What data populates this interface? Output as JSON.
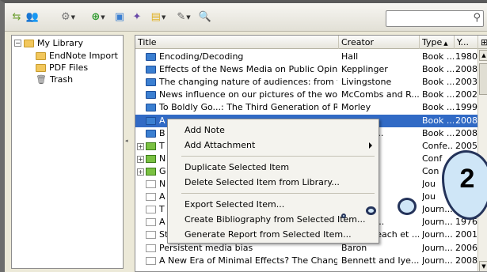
{
  "toolbar": {
    "icons": [
      "sync-icon",
      "group-icon",
      "settings-icon",
      "new-item-icon",
      "new-item-from-file-icon",
      "magic-wand-icon",
      "note-icon",
      "attachment-icon",
      "advanced-search-icon"
    ],
    "search_placeholder": ""
  },
  "library": {
    "root": "My Library",
    "collections": [
      "EndNote Import",
      "PDF Files"
    ],
    "trash": "Trash"
  },
  "table": {
    "columns": {
      "title": "Title",
      "creator": "Creator",
      "type": "Type",
      "year": "Y..."
    },
    "sort_indicator": "▲",
    "rows": [
      {
        "icon": "book",
        "title": "Encoding/Decoding",
        "creator": "Hall",
        "type": "Book ...",
        "year": "1980"
      },
      {
        "icon": "book",
        "title": "Effects of the News Media on Public Opinion",
        "creator": "Kepplinger",
        "type": "Book ...",
        "year": "2008"
      },
      {
        "icon": "book",
        "title": "The changing nature of audiences: from t...",
        "creator": "Livingstone",
        "type": "Book ...",
        "year": "2003"
      },
      {
        "icon": "book",
        "title": "News influence on our pictures of the world",
        "creator": "McCombs and R...",
        "type": "Book ...",
        "year": "2002"
      },
      {
        "icon": "book",
        "title": "To Boldly Go...: The Third Generation of R...",
        "creator": "Morley",
        "type": "Book ...",
        "year": "1999"
      },
      {
        "icon": "book",
        "title": "A",
        "creator": "",
        "type": "Book ...",
        "year": "2008",
        "selected": true
      },
      {
        "icon": "book",
        "title": "B",
        "creator": "n and O...",
        "type": "Book ...",
        "year": "2008"
      },
      {
        "icon": "multi",
        "title": "T",
        "creator": "",
        "type": "Confe...",
        "year": "2005",
        "expander": true
      },
      {
        "icon": "multi",
        "title": "N",
        "creator": "al.",
        "type": "Conf",
        "year": "",
        "expander": true
      },
      {
        "icon": "multi",
        "title": "G",
        "creator": "",
        "type": "Con",
        "year": "",
        "expander": true
      },
      {
        "icon": "doc",
        "title": "N",
        "creator": "d Yu",
        "type": "Jou",
        "year": ""
      },
      {
        "icon": "doc",
        "title": "A",
        "creator": "and T",
        "type": "Jou",
        "year": ""
      },
      {
        "icon": "doc",
        "title": "T",
        "creator": "each",
        "type": "Journ...",
        "year": ""
      },
      {
        "icon": "doc",
        "title": "A",
        "creator": "each an...",
        "type": "Journ...",
        "year": "1976"
      },
      {
        "icon": "doc",
        "title": "Storytelling Neighborhood: Paths to Belon...",
        "creator": "Ball-Rokeach et ...",
        "type": "Journ...",
        "year": "2001"
      },
      {
        "icon": "doc",
        "title": "Persistent media bias",
        "creator": "Baron",
        "type": "Journ...",
        "year": "2006"
      },
      {
        "icon": "doc",
        "title": "A New Era of Minimal Effects? The Changi...",
        "creator": "Bennett and Iye...",
        "type": "Journ...",
        "year": "2008"
      }
    ]
  },
  "context_menu": {
    "add_note": "Add Note",
    "add_attachment": "Add Attachment",
    "duplicate": "Duplicate Selected Item",
    "delete": "Delete Selected Item from Library...",
    "export": "Export Selected Item...",
    "bibliography": "Create Bibliography from Selected Item...",
    "report": "Generate Report from Selected Item..."
  },
  "callout": {
    "number": "2"
  },
  "colors": {
    "selection": "#316ac5",
    "callout_fill": "#cfe6f7",
    "callout_border": "#24335a"
  }
}
